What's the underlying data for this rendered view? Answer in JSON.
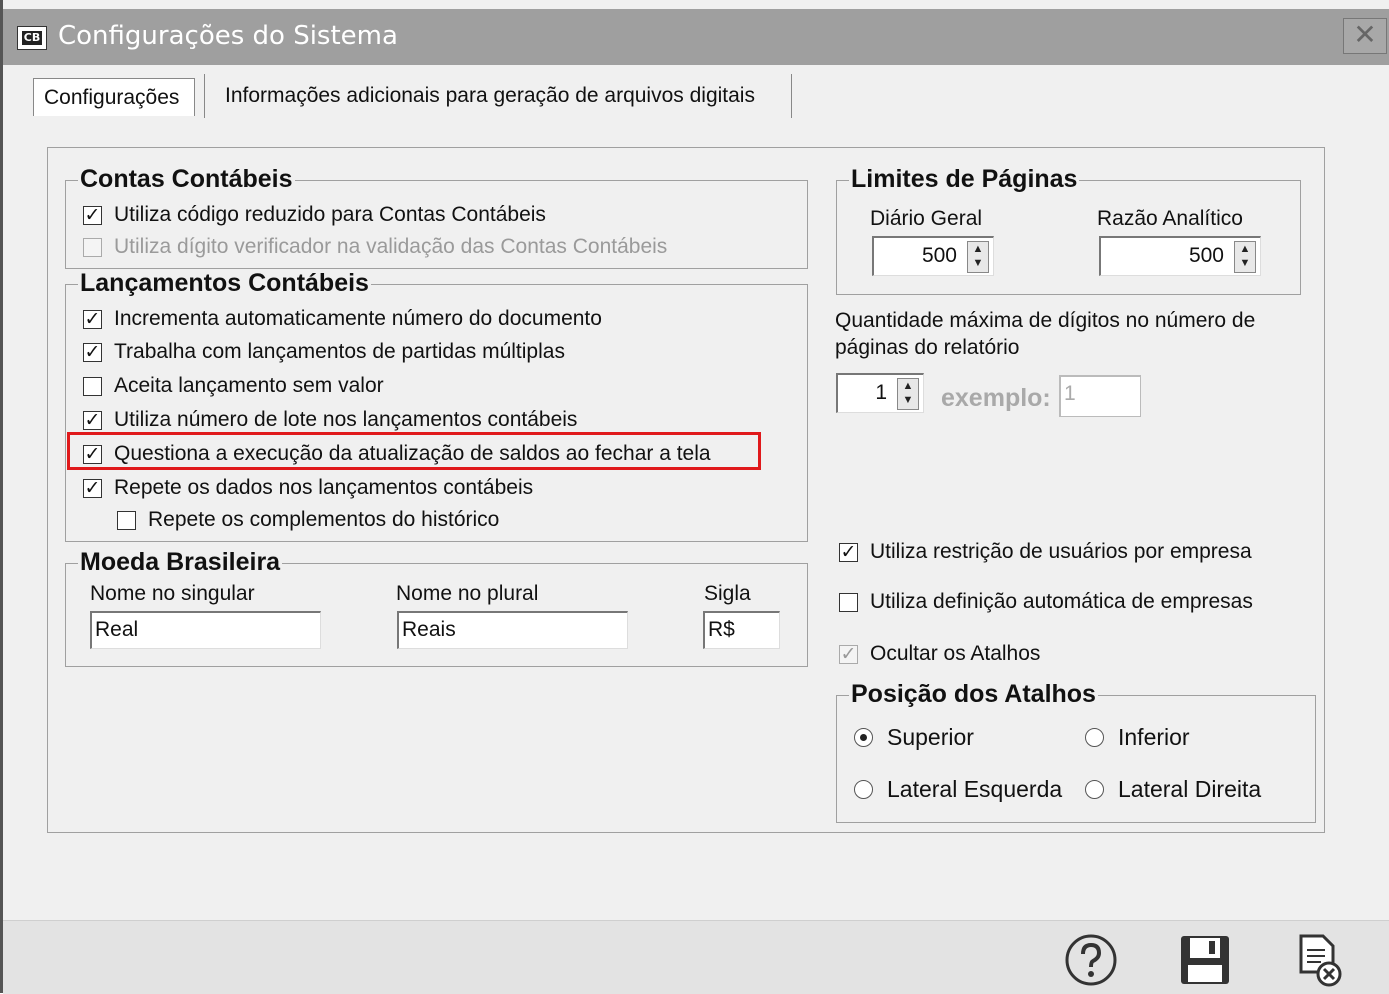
{
  "window": {
    "title": "Configurações do Sistema",
    "app_icon": "CB",
    "close_glyph": "✕"
  },
  "tabs": [
    {
      "label": "Configurações",
      "active": true
    },
    {
      "label": "Informações adicionais para geração de arquivos digitais",
      "active": false
    }
  ],
  "contas": {
    "title": "Contas Contábeis",
    "items": [
      {
        "label": "Utiliza código reduzido para Contas Contábeis",
        "checked": true,
        "enabled": true
      },
      {
        "label": "Utiliza dígito verificador na validação das Contas Contábeis",
        "checked": false,
        "enabled": false
      }
    ]
  },
  "lancamentos": {
    "title": "Lançamentos Contábeis",
    "items": [
      {
        "label": "Incrementa automaticamente número do documento",
        "checked": true
      },
      {
        "label": "Trabalha com lançamentos de partidas múltiplas",
        "checked": true
      },
      {
        "label": "Aceita lançamento sem valor",
        "checked": false
      },
      {
        "label": "Utiliza número de lote nos lançamentos contábeis",
        "checked": true
      },
      {
        "label": "Questiona a execução da atualização de saldos ao fechar a tela",
        "checked": true
      },
      {
        "label": "Repete os dados nos lançamentos contábeis",
        "checked": true
      },
      {
        "label": "Repete os complementos do histórico",
        "checked": false
      }
    ]
  },
  "moeda": {
    "title": "Moeda Brasileira",
    "singular_label": "Nome no singular",
    "singular_value": "Real",
    "plural_label": "Nome no plural",
    "plural_value": "Reais",
    "sigla_label": "Sigla",
    "sigla_value": "R$"
  },
  "limites": {
    "title": "Limites de Páginas",
    "diario_label": "Diário Geral",
    "diario_value": "500",
    "razao_label": "Razão Analítico",
    "razao_value": "500"
  },
  "digitos": {
    "label": "Quantidade máxima de dígitos no número de páginas do relatório",
    "value": "1",
    "exemplo_label": "exemplo:",
    "exemplo_value": "1"
  },
  "opcoes": [
    {
      "label": "Utiliza restrição de usuários por empresa",
      "checked": true,
      "enabled": true
    },
    {
      "label": "Utiliza definição automática de empresas",
      "checked": false,
      "enabled": true
    },
    {
      "label": "Ocultar os Atalhos",
      "checked": true,
      "enabled": false
    }
  ],
  "atalhos": {
    "title": "Posição dos Atalhos",
    "options": [
      {
        "label": "Superior",
        "selected": true
      },
      {
        "label": "Inferior",
        "selected": false
      },
      {
        "label": "Lateral Esquerda",
        "selected": false
      },
      {
        "label": "Lateral Direita",
        "selected": false
      }
    ]
  },
  "toolbar": {
    "help_icon": "help-icon",
    "save_icon": "floppy-disk-icon",
    "cancel_icon": "document-close-icon"
  },
  "colors": {
    "highlight": "#e0191b",
    "titlebar": "#9f9f9f"
  }
}
